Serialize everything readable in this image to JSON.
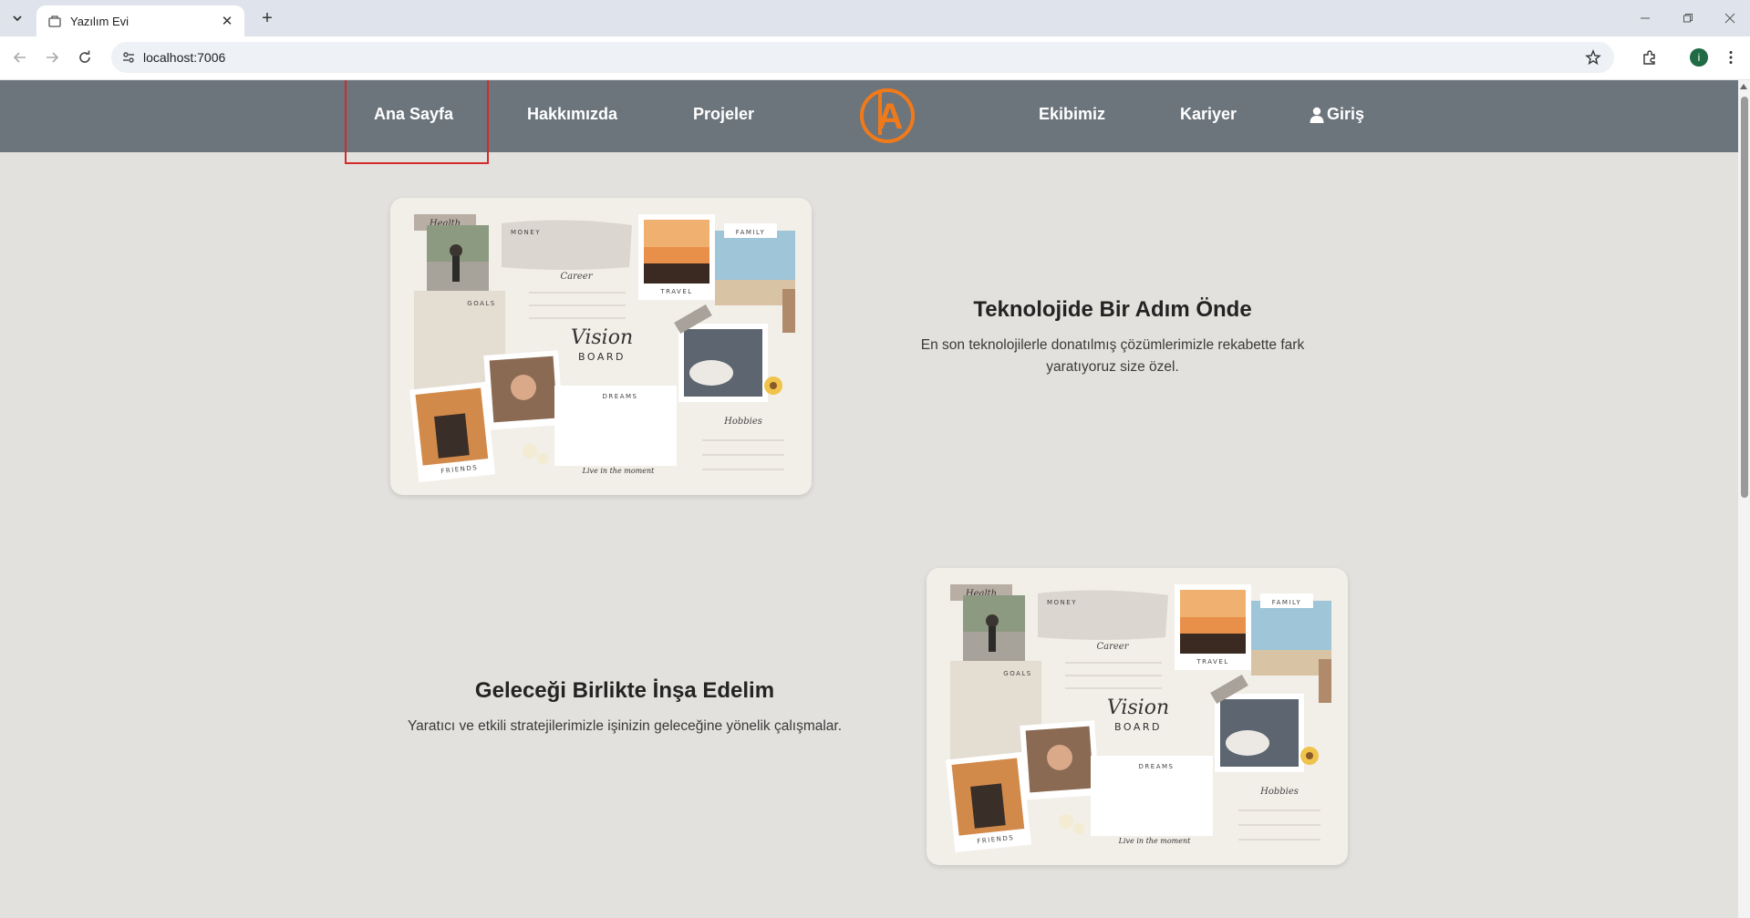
{
  "browser": {
    "tab_title": "Yazılım Evi",
    "url": "localhost:7006",
    "profile_initial": "i",
    "icons": [
      "tab-search-icon",
      "favicon-icon",
      "close-icon",
      "plus-icon",
      "minimize-icon",
      "restore-icon",
      "window-close-icon",
      "back-icon",
      "forward-icon",
      "reload-icon",
      "site-info-icon",
      "star-icon",
      "extensions-icon",
      "menu-icon"
    ]
  },
  "nav": {
    "home": "Ana Sayfa",
    "about": "Hakkımızda",
    "projects": "Projeler",
    "team": "Ekibimiz",
    "career": "Kariyer",
    "login": "Giriş",
    "logo_letter": "A",
    "accent_color": "#f07a1a",
    "bar_color": "#6c747c"
  },
  "sections": [
    {
      "title": "Teknolojide Bir Adım Önde",
      "desc_line1": "En son teknolojilerle donatılmış çözümlerimizle rekabette fark",
      "desc_line2": "yaratıyoruz size özel."
    },
    {
      "title": "Geleceği Birlikte İnşa Edelim",
      "desc_line1": "Yaratıcı ve etkili stratejilerimizle işinizin geleceğine yönelik çalışmalar."
    }
  ],
  "vision_board": {
    "health": "Health",
    "money": "MONEY",
    "family": "FAMILY",
    "career": "Career",
    "travel": "TRAVEL",
    "goals": "GOALS",
    "vision": "Vision",
    "board": "BOARD",
    "dreams": "DREAMS",
    "hobbies": "Hobbies",
    "friends": "FRIENDS",
    "motto": "Live in the moment"
  }
}
